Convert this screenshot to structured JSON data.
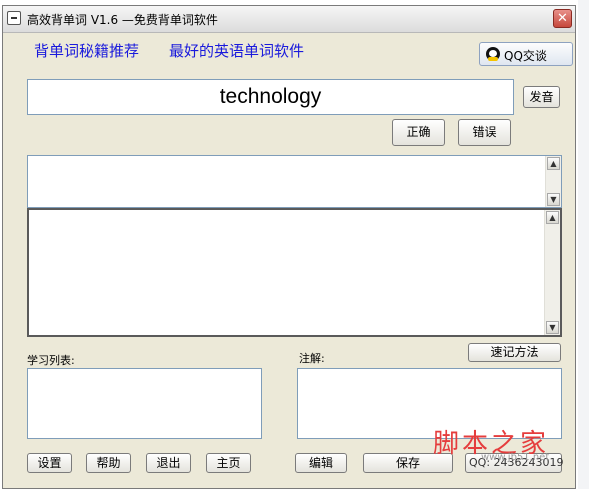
{
  "window": {
    "title": "高效背单词 V1.6 —免费背单词软件",
    "close_label": "✕"
  },
  "header": {
    "link1": "背单词秘籍推荐",
    "link2": "最好的英语单词软件",
    "qq_button": "QQ交谈"
  },
  "word": {
    "text": "technology"
  },
  "buttons": {
    "pronounce": "发音",
    "correct": "正确",
    "wrong": "错误",
    "memory_method": "速记方法",
    "settings": "设置",
    "help": "帮助",
    "exit": "退出",
    "home": "主页",
    "edit": "编辑",
    "save": "保存"
  },
  "labels": {
    "study_list": "学习列表:",
    "notes": "注解:"
  },
  "footer": {
    "qq_number": "QQ: 2436243019"
  },
  "watermark": {
    "text": "脚本之家",
    "url": "www.jb51.net"
  },
  "colors": {
    "link": "#1a1adc",
    "watermark": "#e53d3d"
  }
}
